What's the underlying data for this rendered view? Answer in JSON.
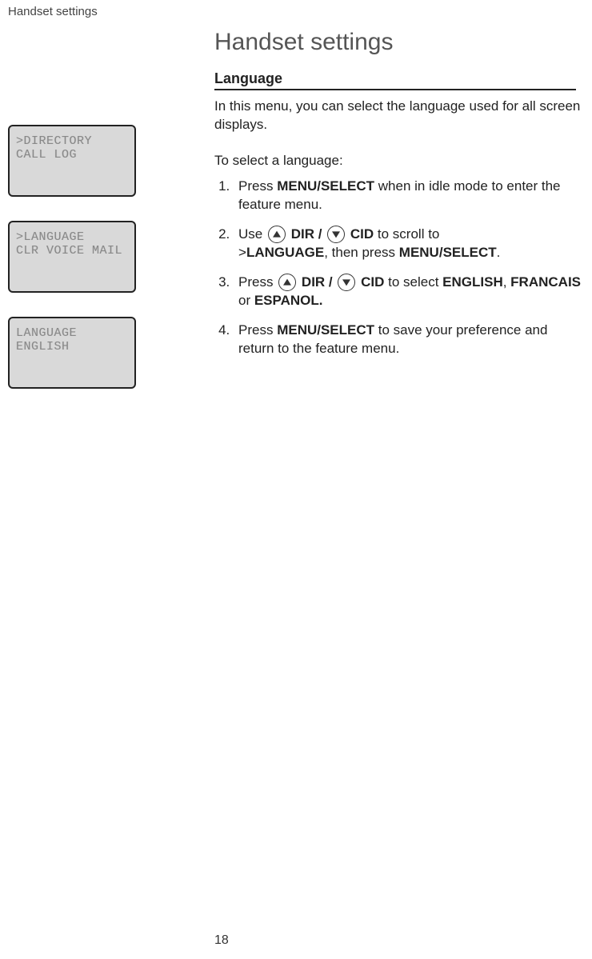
{
  "header": {
    "section": "Handset settings"
  },
  "title": "Handset settings",
  "subsection": "Language",
  "paragraphs": {
    "p1": "In this menu, you can select the language used for all screen displays.",
    "p2": "To select a language:"
  },
  "steps": {
    "s1_pre": "Press ",
    "s1_b1": "MENU/",
    "s1_b1b": "SELECT",
    "s1_post": " when in idle mode to enter the feature menu.",
    "s2_pre": "Use ",
    "s2_dir": "DIR / ",
    "s2_cid": "CID",
    "s2_mid": "  to scroll to ",
    "s2_caret": ">",
    "s2_lang": "LANGUAGE",
    "s2_then": ", then press ",
    "s2_menu": "MENU",
    "s2_select": "/SELECT",
    "s2_end": ".",
    "s3_pre": "Press ",
    "s3_dir": "DIR / ",
    "s3_cid": "CID",
    "s3_mid": "  to select ",
    "s3_eng": "ENGLISH",
    "s3_comma": ", ",
    "s3_fra": "FRANCAIS",
    "s3_or": " or ",
    "s3_esp": "ESPANOL.",
    "s4_pre": "Press ",
    "s4_menu": "MENU",
    "s4_select": "/SELECT",
    "s4_post": " to save your preference and return to the feature menu."
  },
  "lcd1": {
    "caret": ">",
    "line1": "DIRECTORY",
    "line2": " CALL LOG"
  },
  "lcd2": {
    "caret": ">",
    "line1": "LANGUAGE",
    "line2": " CLR VOICE MAIL"
  },
  "lcd3": {
    "line1": "LANGUAGE",
    "line2": "ENGLISH"
  },
  "pageNumber": "18"
}
